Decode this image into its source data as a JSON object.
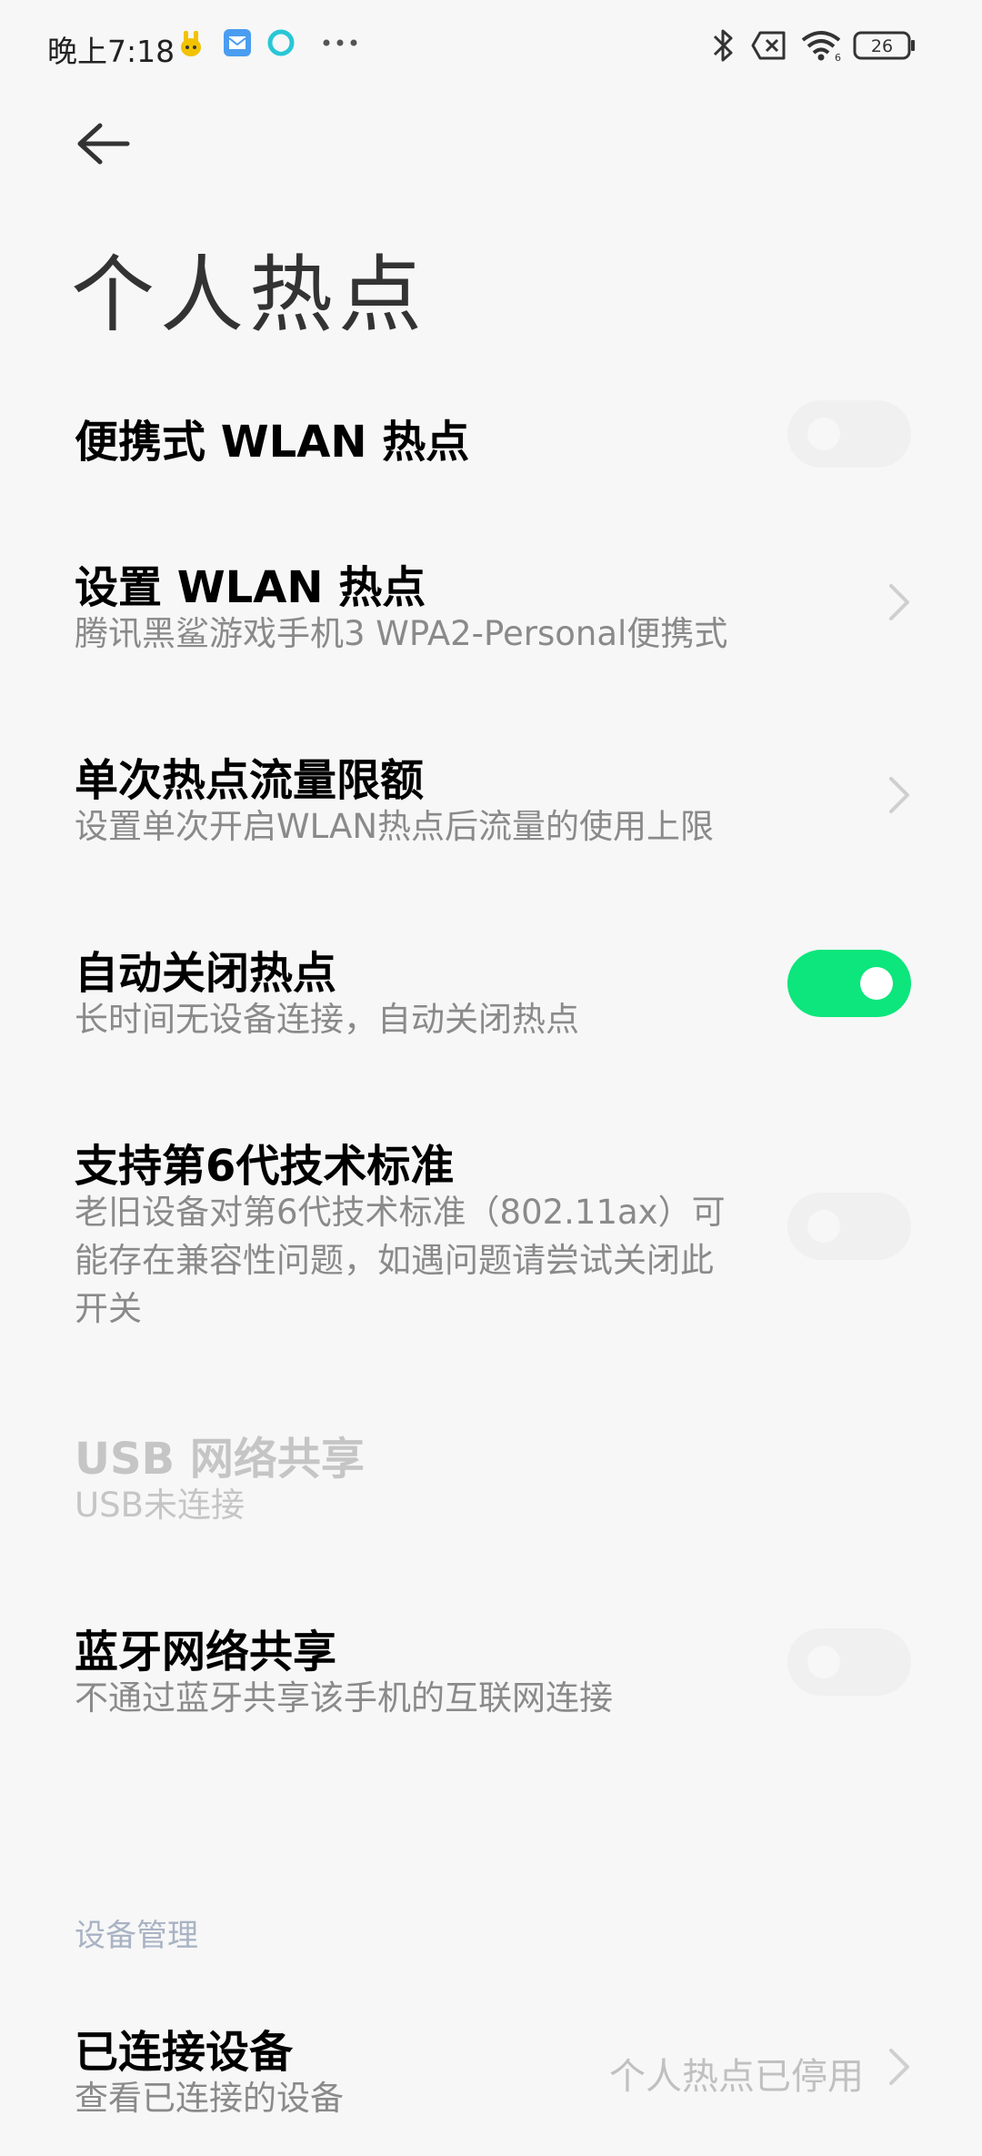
{
  "status_bar": {
    "time": "晚上7:18",
    "battery": "26"
  },
  "page": {
    "title": "个人热点"
  },
  "rows": [
    {
      "title": "便携式 WLAN 热点"
    },
    {
      "title": "设置 WLAN 热点",
      "subtitle": "腾讯黑鲨游戏手机3 WPA2-Personal便携式"
    },
    {
      "title": "单次热点流量限额",
      "subtitle": "设置单次开启WLAN热点后流量的使用上限"
    },
    {
      "title": "自动关闭热点",
      "subtitle": "长时间无设备连接，自动关闭热点"
    },
    {
      "title": "支持第6代技术标准",
      "subtitle": "老旧设备对第6代技术标准（802.11ax）可\n能存在兼容性问题，如遇问题请尝试关闭此\n开关"
    },
    {
      "title": "USB 网络共享",
      "subtitle": "USB未连接"
    },
    {
      "title": "蓝牙网络共享",
      "subtitle": "不通过蓝牙共享该手机的互联网连接"
    }
  ],
  "section_header": "设备管理",
  "connected": {
    "title": "已连接设备",
    "subtitle": "查看已连接的设备",
    "value": "个人热点已停用"
  },
  "toggles": {
    "portable_hotspot": false,
    "auto_close": true,
    "wifi6": false,
    "bluetooth_tethering": false
  },
  "colors": {
    "accent": "#0ce67c"
  }
}
